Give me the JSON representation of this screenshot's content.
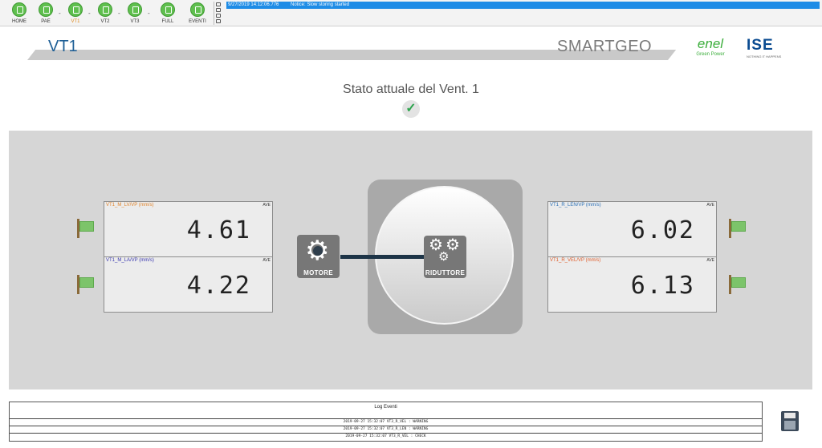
{
  "toolbar": {
    "nav": [
      {
        "label": "HOME"
      },
      {
        "label": "PAE"
      },
      {
        "label": "VT1"
      },
      {
        "label": "VT2"
      },
      {
        "label": "VT3"
      },
      {
        "label": "FULL"
      },
      {
        "label": "EVENTI"
      }
    ],
    "separator": "-",
    "status_timestamp": "9/27/2019 14:12:06.776",
    "status_message": "Notice: Slow storing started"
  },
  "header": {
    "page_title": "VT1",
    "app_name": "SMARTGEO",
    "enel_word": "enel",
    "enel_sub": "Green Power",
    "ise_word": "ISE",
    "ise_sub": "NOTHING IT HAPPENS"
  },
  "status": {
    "title": "Stato attuale del Vent. 1",
    "check": "✓"
  },
  "sensors": [
    {
      "label": "VT1_M_LV/VP (mm/s)",
      "badge": "AVE",
      "value": "4.61",
      "color": "#e0832a"
    },
    {
      "label": "VT1_M_LA/VP (mm/s)",
      "badge": "AVE",
      "value": "4.22",
      "color": "#3a38b0"
    },
    {
      "label": "VT1_R_LEN/VP (mm/s)",
      "badge": "AVE",
      "value": "6.02",
      "color": "#2a6fb5"
    },
    {
      "label": "VT1_R_VEL/VP (mm/s)",
      "badge": "AVE",
      "value": "6.13",
      "color": "#e05c2a"
    }
  ],
  "machine": {
    "motor_label": "MOTORE",
    "reducer_label": "RIDUTTORE"
  },
  "log": {
    "title": "Log Eventi",
    "rows": [
      "2019-09-27 15:32:07 VT3_R_VEL : WARNING",
      "2019-09-27 15:32:07 VT3_R_LEN : WARNING",
      "2019-09-27 15:32:07 VT3_R_VEL : CHECK"
    ]
  }
}
